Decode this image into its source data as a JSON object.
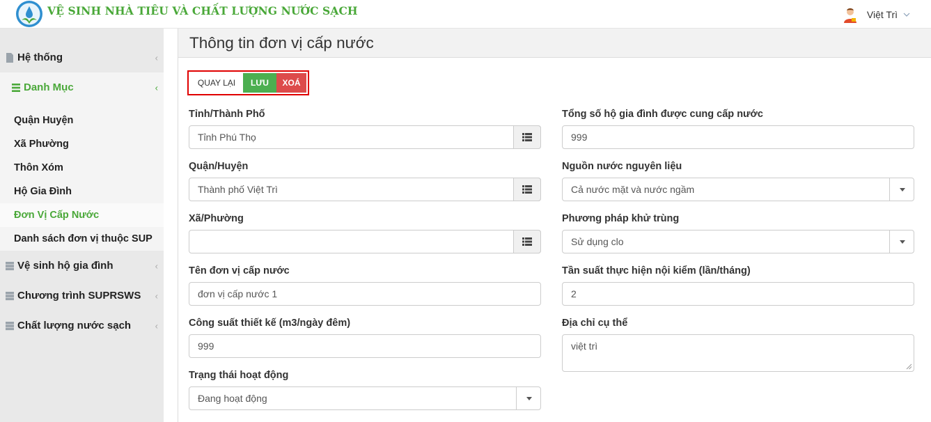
{
  "app": {
    "title": "VỆ SINH NHÀ TIÊU VÀ CHẤT LƯỢNG NƯỚC SẠCH",
    "logo_icon": "leaf-drop-logo",
    "brand_color": "#4aa839"
  },
  "user": {
    "name": "Việt Trì",
    "avatar_icon": "user-avatar-icon"
  },
  "sidebar": {
    "items": [
      {
        "label": "Hệ thống",
        "icon": "file-icon"
      },
      {
        "label": "Danh Mục",
        "icon": "list-icon",
        "expanded": true
      },
      {
        "label": "Vệ sinh hộ gia đình",
        "icon": "server-icon"
      },
      {
        "label": "Chương trình SUPRSWS",
        "icon": "server-icon"
      },
      {
        "label": "Chất lượng nước sạch",
        "icon": "server-icon"
      }
    ],
    "sub_items": [
      {
        "label": "Quận Huyện"
      },
      {
        "label": "Xã Phường"
      },
      {
        "label": "Thôn Xóm"
      },
      {
        "label": "Hộ Gia Đình"
      },
      {
        "label": "Đơn Vị Cấp Nước",
        "current": true
      },
      {
        "label": "Danh sách đơn vị thuộc SUP"
      }
    ]
  },
  "page": {
    "title": "Thông tin đơn vị cấp nước"
  },
  "toolbar": {
    "back_label": "QUAY LẠI",
    "save_label": "LƯU",
    "delete_label": "XOÁ",
    "save_color": "#4caf50",
    "delete_color": "#dd4b4b"
  },
  "form": {
    "province": {
      "label": "Tỉnh/Thành Phố",
      "value": "Tỉnh Phú Thọ"
    },
    "district": {
      "label": "Quận/Huyện",
      "value": "Thành phố Việt Trì"
    },
    "ward": {
      "label": "Xã/Phường",
      "value": ""
    },
    "unit_name": {
      "label": "Tên đơn vị cấp nước",
      "value": "đơn vị cấp nước 1"
    },
    "capacity": {
      "label": "Công suất thiết kế (m3/ngày đêm)",
      "value": "999"
    },
    "status": {
      "label": "Trạng thái hoạt động",
      "value": "Đang hoạt động"
    },
    "households": {
      "label": "Tổng số hộ gia đình được cung cấp nước",
      "value": "999"
    },
    "water_source": {
      "label": "Nguồn nước nguyên liệu",
      "value": "Cả nước mặt và nước ngầm"
    },
    "disinfection": {
      "label": "Phương pháp khử trùng",
      "value": "Sử dụng clo"
    },
    "frequency": {
      "label": "Tần suất thực hiện nội kiểm (lần/tháng)",
      "value": "2"
    },
    "address": {
      "label": "Địa chỉ cụ thể",
      "value": "việt trì"
    }
  }
}
